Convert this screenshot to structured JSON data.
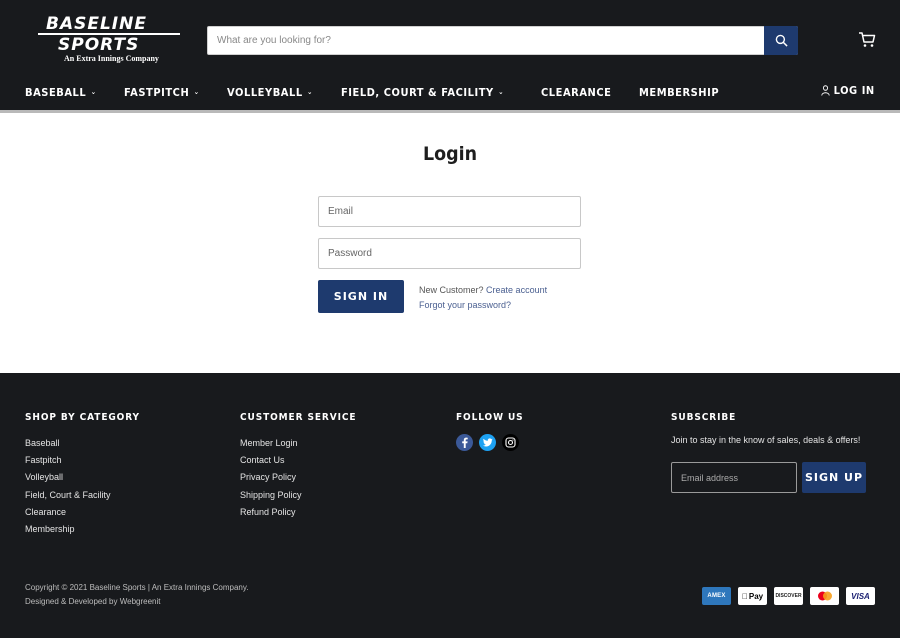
{
  "brand": {
    "line1": "BASELINE",
    "line2": "SPORTS",
    "tagline": "An Extra Innings Company"
  },
  "search": {
    "placeholder": "What are you looking for?"
  },
  "nav": {
    "items": [
      {
        "label": "BASEBALL",
        "has_dropdown": true
      },
      {
        "label": "FASTPITCH",
        "has_dropdown": true
      },
      {
        "label": "VOLLEYBALL",
        "has_dropdown": true
      },
      {
        "label": "FIELD, COURT & FACILITY",
        "has_dropdown": true
      },
      {
        "label": "CLEARANCE",
        "has_dropdown": false
      },
      {
        "label": "MEMBERSHIP",
        "has_dropdown": false
      }
    ],
    "login_label": "LOG IN"
  },
  "main": {
    "title": "Login",
    "email_placeholder": "Email",
    "password_placeholder": "Password",
    "signin_label": "SIGN IN",
    "new_customer_text": "New Customer?",
    "create_account_label": "Create account",
    "forgot_password_label": "Forgot your password?"
  },
  "footer": {
    "shop": {
      "heading": "SHOP BY CATEGORY",
      "items": [
        "Baseball",
        "Fastpitch",
        "Volleyball",
        "Field, Court & Facility",
        "Clearance",
        "Membership"
      ]
    },
    "service": {
      "heading": "CUSTOMER SERVICE",
      "items": [
        "Member Login",
        "Contact Us",
        "Privacy Policy",
        "Shipping Policy",
        "Refund Policy"
      ]
    },
    "follow": {
      "heading": "FOLLOW US",
      "icons": [
        "facebook-icon",
        "twitter-icon",
        "instagram-icon"
      ]
    },
    "subscribe": {
      "heading": "SUBSCRIBE",
      "text": "Join to stay in the know of sales, deals & offers!",
      "email_placeholder": "Email address",
      "button_label": "SIGN UP"
    },
    "copyright_line1": "Copyright © 2021 Baseline Sports | An Extra Innings Company.",
    "copyright_line2": "Designed & Developed by Webgreenit",
    "payments": [
      "AMEX",
      "Pay",
      "DISCOVER",
      "mastercard",
      "VISA"
    ]
  },
  "colors": {
    "header_bg": "#181a1d",
    "accent": "#1e3a6e",
    "link": "#4a5f90"
  }
}
